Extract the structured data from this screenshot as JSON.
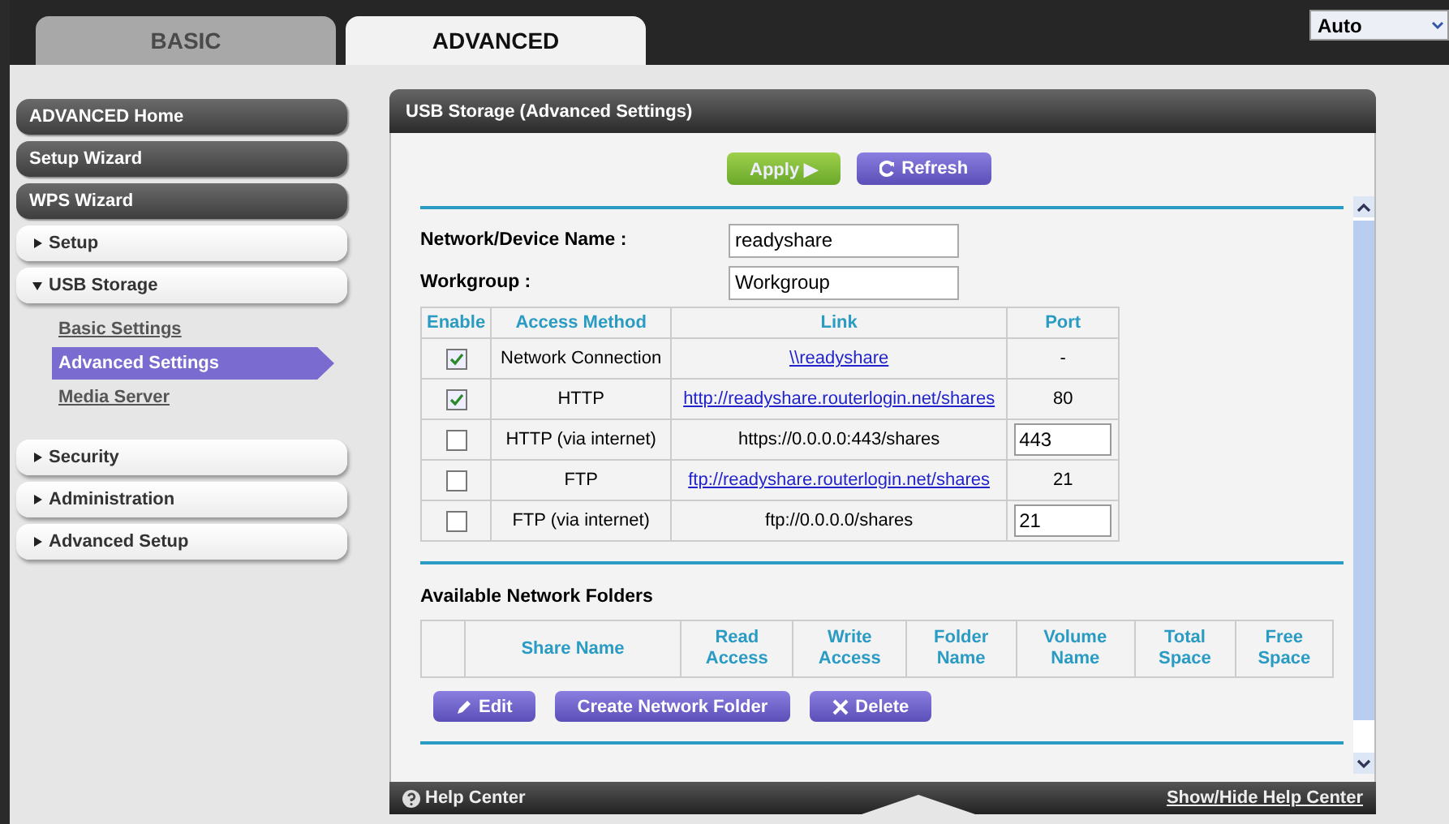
{
  "tabs": [
    {
      "label": "BASIC",
      "selected": false
    },
    {
      "label": "ADVANCED",
      "selected": true
    }
  ],
  "language": {
    "value": "Auto"
  },
  "sidebar": {
    "items": [
      {
        "label": "ADVANCED Home",
        "kind": "dark"
      },
      {
        "label": "Setup Wizard",
        "kind": "dark"
      },
      {
        "label": "WPS Wizard",
        "kind": "dark"
      },
      {
        "label": "Setup",
        "kind": "section",
        "expanded": false
      },
      {
        "label": "USB Storage",
        "kind": "section",
        "expanded": true,
        "children": [
          {
            "label": "Basic Settings",
            "selected": false
          },
          {
            "label": "Advanced Settings",
            "selected": true
          },
          {
            "label": "Media Server",
            "selected": false
          }
        ]
      },
      {
        "label": "Security",
        "kind": "section",
        "expanded": false
      },
      {
        "label": "Administration",
        "kind": "section",
        "expanded": false
      },
      {
        "label": "Advanced Setup",
        "kind": "section",
        "expanded": false
      }
    ]
  },
  "panel": {
    "title": "USB Storage (Advanced Settings)",
    "buttons": [
      {
        "label": "Apply ▶",
        "kind": "apply"
      },
      {
        "label": "Refresh",
        "kind": "refresh"
      }
    ],
    "fields": [
      {
        "label": "Network/Device Name :",
        "value": "readyshare"
      },
      {
        "label": "Workgroup :",
        "value": "Workgroup"
      }
    ],
    "access_table": {
      "columns": [
        "Enable",
        "Access Method",
        "Link",
        "Port"
      ],
      "rows": [
        {
          "checked": true,
          "method": "Network Connection",
          "link": {
            "text": "\\\\readyshare",
            "kind": "link"
          },
          "port": {
            "text": "-",
            "kind": "text"
          }
        },
        {
          "checked": true,
          "method": "HTTP",
          "link": {
            "text": "http://readyshare.routerlogin.net/shares",
            "kind": "link"
          },
          "port": {
            "text": "80",
            "kind": "text"
          }
        },
        {
          "checked": false,
          "method": "HTTP (via internet)",
          "link": {
            "text": "https://0.0.0.0:443/shares",
            "kind": "text"
          },
          "port": {
            "text": "443",
            "kind": "input"
          }
        },
        {
          "checked": false,
          "method": "FTP",
          "link": {
            "text": "ftp://readyshare.routerlogin.net/shares",
            "kind": "link"
          },
          "port": {
            "text": "21",
            "kind": "text"
          }
        },
        {
          "checked": false,
          "method": "FTP (via internet)",
          "link": {
            "text": "ftp://0.0.0.0/shares",
            "kind": "text"
          },
          "port": {
            "text": "21",
            "kind": "input"
          }
        }
      ]
    },
    "folders": {
      "title": "Available Network Folders",
      "columns": [
        "",
        "Share Name",
        "Read Access",
        "Write Access",
        "Folder Name",
        "Volume Name",
        "Total Space",
        "Free Space"
      ],
      "buttons": [
        {
          "label": "Edit",
          "kind": "edit"
        },
        {
          "label": "Create Network Folder",
          "kind": "plain"
        },
        {
          "label": "Delete",
          "kind": "delete"
        }
      ]
    }
  },
  "footer": {
    "help": "Help Center",
    "toggle": "Show/Hide Help Center"
  }
}
